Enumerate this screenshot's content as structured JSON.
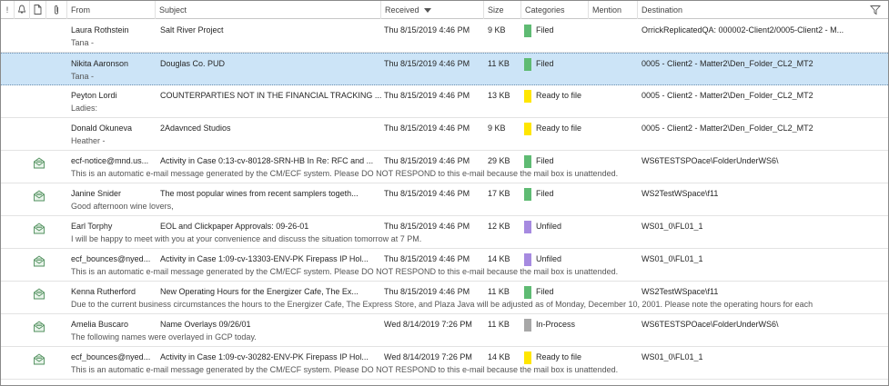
{
  "header": {
    "icon_importance": "!",
    "icon_reminder": "bell-icon",
    "icon_document": "document-icon",
    "icon_attachment": "paperclip-icon",
    "from": "From",
    "subject": "Subject",
    "received": "Received",
    "size": "Size",
    "categories": "Categories",
    "mention": "Mention",
    "destination": "Destination"
  },
  "colors": {
    "green": "#5fbb73",
    "yellow": "#ffe600",
    "purple": "#a68ae0",
    "gray": "#a7a7a7",
    "selected": "#cce4f7"
  },
  "messages": [
    {
      "from": "Laura Rothstein",
      "subject": "Salt River Project",
      "received": "Thu 8/15/2019 4:46 PM",
      "size": "9 KB",
      "category": "Filed",
      "category_color": "#5fbb73",
      "destination": "OrrickReplicatedQA: 000002-Client2/0005-Client2 - M...",
      "preview": "Tana -",
      "has_icon": false,
      "selected": false
    },
    {
      "from": "Nikita Aaronson",
      "subject": "Douglas Co. PUD",
      "received": "Thu 8/15/2019 4:46 PM",
      "size": "11 KB",
      "category": "Filed",
      "category_color": "#5fbb73",
      "destination": "0005 - Client2 - Matter2\\Den_Folder_CL2_MT2",
      "preview": "Tana -",
      "has_icon": false,
      "selected": true
    },
    {
      "from": "Peyton Lordi",
      "subject": "COUNTERPARTIES NOT IN THE FINANCIAL TRACKING ...",
      "received": "Thu 8/15/2019 4:46 PM",
      "size": "13 KB",
      "category": "Ready to file",
      "category_color": "#ffe600",
      "destination": "0005 - Client2 - Matter2\\Den_Folder_CL2_MT2",
      "preview": "Ladies:",
      "has_icon": false,
      "selected": false
    },
    {
      "from": "Donald Okuneva",
      "subject": "2Adavnced Studios",
      "received": "Thu 8/15/2019 4:46 PM",
      "size": "9 KB",
      "category": "Ready to file",
      "category_color": "#ffe600",
      "destination": "0005 - Client2 - Matter2\\Den_Folder_CL2_MT2",
      "preview": "Heather -",
      "has_icon": false,
      "selected": false
    },
    {
      "from": "ecf-notice@mnd.us...",
      "subject": "Activity in Case 0:13-cv-80128-SRN-HB In Re: RFC and ...",
      "received": "Thu 8/15/2019 4:46 PM",
      "size": "29 KB",
      "category": "Filed",
      "category_color": "#5fbb73",
      "destination": "WS6TESTSPOace\\FolderUnderWS6\\",
      "preview": "This is an automatic e-mail message generated by the CM/ECF system. Please DO NOT RESPOND to this e-mail because the mail box is unattended.",
      "has_icon": true,
      "selected": false
    },
    {
      "from": "Janine Snider",
      "subject": "The most popular wines from recent samplers togeth...",
      "received": "Thu 8/15/2019 4:46 PM",
      "size": "17 KB",
      "category": "Filed",
      "category_color": "#5fbb73",
      "destination": "WS2TestWSpace\\f11",
      "preview": "Good afternoon wine lovers,",
      "has_icon": true,
      "selected": false
    },
    {
      "from": "Earl Torphy",
      "subject": "EOL and Clickpaper Approvals: 09-26-01",
      "received": "Thu 8/15/2019 4:46 PM",
      "size": "12 KB",
      "category": "Unfiled",
      "category_color": "#a68ae0",
      "destination": "WS01_0\\FL01_1",
      "preview": "I will be happy to meet with you at your convenience and discuss the situation tomorrow at  7 PM.",
      "has_icon": true,
      "selected": false
    },
    {
      "from": "ecf_bounces@nyed...",
      "subject": "Activity in Case 1:09-cv-13303-ENV-PK Firepass IP Hol...",
      "received": "Thu 8/15/2019 4:46 PM",
      "size": "14 KB",
      "category": "Unfiled",
      "category_color": "#a68ae0",
      "destination": "WS01_0\\FL01_1",
      "preview": "This is an automatic e-mail message generated by the CM/ECF system. Please DO NOT RESPOND to this e-mail because the mail box is unattended.",
      "has_icon": true,
      "selected": false
    },
    {
      "from": "Kenna Rutherford",
      "subject": "New Operating Hours for the Energizer Cafe, The Ex...",
      "received": "Thu 8/15/2019 4:46 PM",
      "size": "11 KB",
      "category": "Filed",
      "category_color": "#5fbb73",
      "destination": "WS2TestWSpace\\f11",
      "preview": "Due to the current business circumstances the hours to the Energizer Cafe, The Express Store, and Plaza Java will be adjusted as of Monday, December 10, 2001.  Please note the operating hours for each",
      "has_icon": true,
      "selected": false
    },
    {
      "from": "Amelia Buscaro",
      "subject": "Name Overlays 09/26/01",
      "received": "Wed 8/14/2019 7:26 PM",
      "size": "11 KB",
      "category": "In-Process",
      "category_color": "#a7a7a7",
      "destination": "WS6TESTSPOace\\FolderUnderWS6\\",
      "preview": "The following names were overlayed in GCP today.",
      "has_icon": true,
      "selected": false
    },
    {
      "from": "ecf_bounces@nyed...",
      "subject": "Activity in Case 1:09-cv-30282-ENV-PK Firepass IP Hol...",
      "received": "Wed 8/14/2019 7:26 PM",
      "size": "14 KB",
      "category": "Ready to file",
      "category_color": "#ffe600",
      "destination": "WS01_0\\FL01_1",
      "preview": "This is an automatic e-mail message generated by the CM/ECF system. Please DO NOT RESPOND to this e-mail because the mail box is unattended.",
      "has_icon": true,
      "selected": false
    }
  ]
}
